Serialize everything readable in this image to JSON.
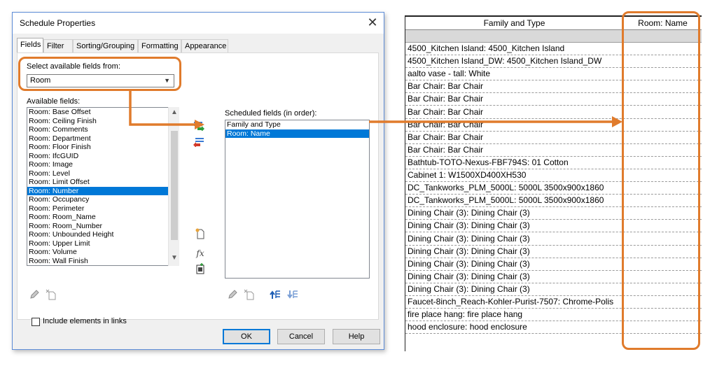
{
  "dialog": {
    "title": "Schedule Properties",
    "tabs": [
      "Fields",
      "Filter",
      "Sorting/Grouping",
      "Formatting",
      "Appearance"
    ],
    "select_from_label": "Select available fields from:",
    "select_from_value": "Room",
    "available_label": "Available fields:",
    "available_fields": [
      "Room: Base Offset",
      "Room: Ceiling Finish",
      "Room: Comments",
      "Room: Department",
      "Room: Floor Finish",
      "Room: IfcGUID",
      "Room: Image",
      "Room: Level",
      "Room: Limit Offset",
      "Room: Number",
      "Room: Occupancy",
      "Room: Perimeter",
      "Room: Room_Name",
      "Room: Room_Number",
      "Room: Unbounded Height",
      "Room: Upper Limit",
      "Room: Volume",
      "Room: Wall Finish"
    ],
    "available_selected_index": 9,
    "scheduled_label": "Scheduled fields (in order):",
    "scheduled_fields": [
      "Family and Type",
      "Room: Name"
    ],
    "scheduled_selected_index": 1,
    "include_links_label": "Include elements in links",
    "ok": "OK",
    "cancel": "Cancel",
    "help": "Help",
    "fx_label": "fx"
  },
  "schedule": {
    "headers": [
      "Family and Type",
      "Room: Name"
    ],
    "rows": [
      "4500_Kitchen Island: 4500_Kitchen Island",
      "4500_Kitchen Island_DW: 4500_Kitchen Island_DW",
      "aalto vase - tall: White",
      "Bar Chair: Bar Chair",
      "Bar Chair: Bar Chair",
      "Bar Chair: Bar Chair",
      "Bar Chair: Bar Chair",
      "Bar Chair: Bar Chair",
      "Bar Chair: Bar Chair",
      "Bathtub-TOTO-Nexus-FBF794S: 01 Cotton",
      "Cabinet 1: W1500XD400XH530",
      "DC_Tankworks_PLM_5000L: 5000L 3500x900x1860",
      "DC_Tankworks_PLM_5000L: 5000L 3500x900x1860",
      "Dining Chair (3): Dining Chair (3)",
      "Dining Chair (3): Dining Chair (3)",
      "Dining Chair (3): Dining Chair (3)",
      "Dining Chair (3): Dining Chair (3)",
      "Dining Chair (3): Dining Chair (3)",
      "Dining Chair (3): Dining Chair (3)",
      "Dining Chair (3): Dining Chair (3)",
      "Faucet-8inch_Reach-Kohler-Purist-7507: Chrome-Polis",
      "fire place hang: fire place hang",
      "hood enclosure: hood enclosure"
    ]
  },
  "colors": {
    "callout": "#e07b2c",
    "selection": "#0078d7"
  }
}
